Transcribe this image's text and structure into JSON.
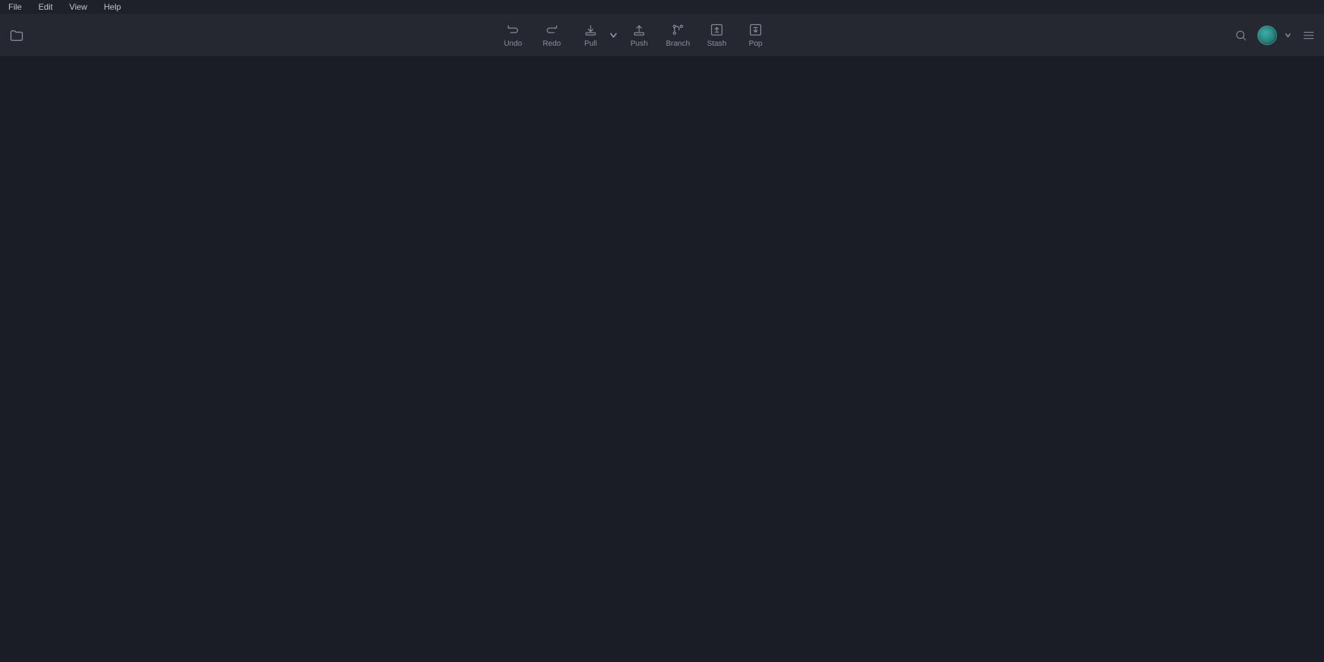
{
  "menu": {
    "items": [
      {
        "label": "File",
        "id": "file"
      },
      {
        "label": "Edit",
        "id": "edit"
      },
      {
        "label": "View",
        "id": "view"
      },
      {
        "label": "Help",
        "id": "help"
      }
    ]
  },
  "toolbar": {
    "buttons": [
      {
        "id": "undo",
        "label": "Undo"
      },
      {
        "id": "redo",
        "label": "Redo"
      },
      {
        "id": "pull",
        "label": "Pull"
      },
      {
        "id": "push",
        "label": "Push"
      },
      {
        "id": "branch",
        "label": "Branch"
      },
      {
        "id": "stash",
        "label": "Stash"
      },
      {
        "id": "pop",
        "label": "Pop"
      }
    ],
    "folder_icon": "folder-icon",
    "search_icon": "search-icon",
    "avatar_icon": "avatar-icon",
    "chevron_icon": "chevron-down-icon",
    "menu_icon": "hamburger-icon"
  }
}
